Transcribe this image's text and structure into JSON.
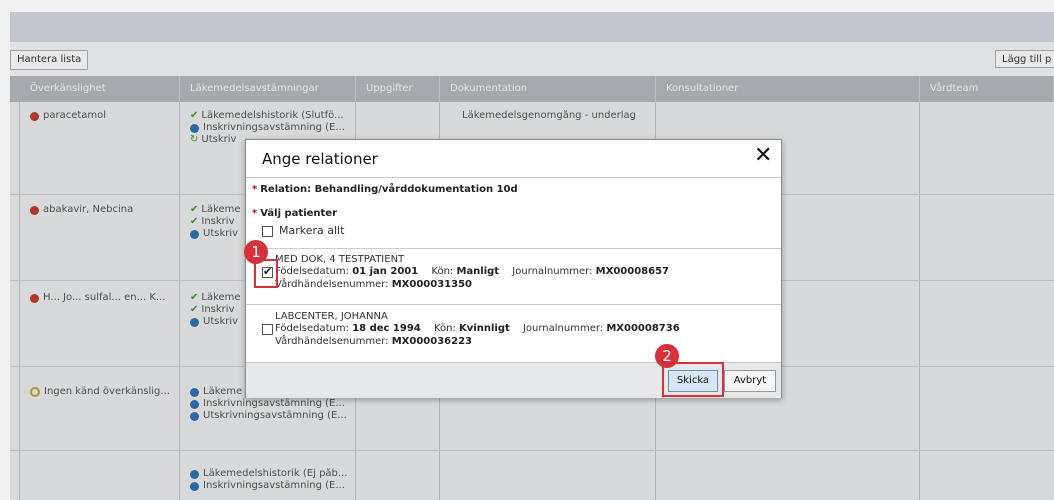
{
  "toolbar": {
    "manage_list": "Hantera lista",
    "add_label": "Lägg till p"
  },
  "columns": [
    "Överkänslighet",
    "Läkemedelsavstämningar",
    "Uppgifter",
    "Dokumentation",
    "Konsultationer",
    "Vårdteam"
  ],
  "rows": [
    {
      "allergy": "paracetamol",
      "med1": "Läkemedelshistorik (Slutfö...",
      "med2": "Inskrivningsavstämning (E...",
      "med3": "Utskriv",
      "doc": "Läkemedelsgenomgång - underlag"
    },
    {
      "allergy": "abakavir, Nebcina",
      "med1": "Läkeme",
      "med2": "Inskriv",
      "med3": "Utskriv"
    },
    {
      "allergy": "H... Jo... sulfal... en... K...",
      "med1": "Läkeme",
      "med2": "Inskriv",
      "med3": "Utskriv"
    },
    {
      "allergy": "Ingen känd överkänslig...",
      "med1": "Läkeme",
      "med2": "Inskrivningsavstämning (E...",
      "med3": "Utskrivningsavstämning (E..."
    },
    {
      "allergy": "",
      "med1": "Läkemedelshistorik (Ej påb...",
      "med2": "Inskrivningsavstämning (E...",
      "med3": ""
    }
  ],
  "dialog": {
    "title": "Ange relationer",
    "close_glyph": "✕",
    "relation_label": "Relation: Behandling/vårddokumentation 10d",
    "patients_label": "Välj patienter",
    "required_mark": "*",
    "select_all": "Markera allt",
    "patients": [
      {
        "name": "MED DOK, 4 TESTPATIENT",
        "checked": true,
        "dob_label": "Födelsedatum:",
        "dob": "01 jan 2001",
        "sex_label": "Kön:",
        "sex": "Manligt",
        "journal_label": "Journalnummer:",
        "journal": "MX00008657",
        "event_label": "Vårdhändelsenummer:",
        "event": "MX000031350"
      },
      {
        "name": "LABCENTER, JOHANNA",
        "checked": false,
        "dob_label": "Födelsedatum:",
        "dob": "18 dec 1994",
        "sex_label": "Kön:",
        "sex": "Kvinnligt",
        "journal_label": "Journalnummer:",
        "journal": "MX00008736",
        "event_label": "Vårdhändelsenummer:",
        "event": "MX000036223"
      }
    ],
    "send_label": "Skicka",
    "cancel_label": "Avbryt"
  },
  "annotations": {
    "step1": "1",
    "step2": "2",
    "color": "#d7303a"
  },
  "colors": {
    "header": "#b1b4b8",
    "grid_bg": "#e6e7e8",
    "check_green": "#3f9a2e",
    "info_blue": "#2d6fb3",
    "allergy_red": "#c0392b"
  }
}
